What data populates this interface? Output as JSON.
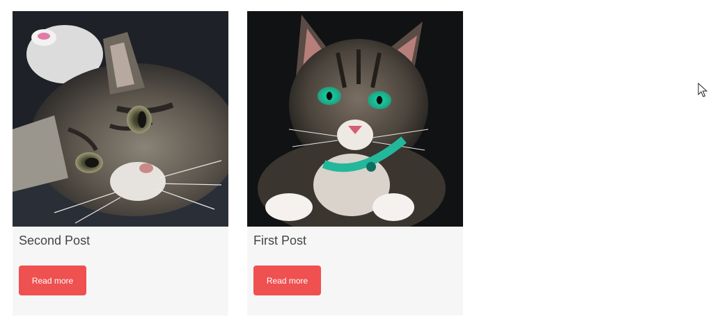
{
  "posts": [
    {
      "title": "Second Post",
      "button_label": "Read more",
      "image": "tabby-cat-lying-on-side"
    },
    {
      "title": "First Post",
      "button_label": "Read more",
      "image": "tabby-cat-green-eyes-collar"
    }
  ],
  "colors": {
    "button": "#ef5050",
    "card_background": "#f6f6f6",
    "title_text": "#444444"
  },
  "icons": {
    "cursor": "mouse-pointer-icon"
  }
}
